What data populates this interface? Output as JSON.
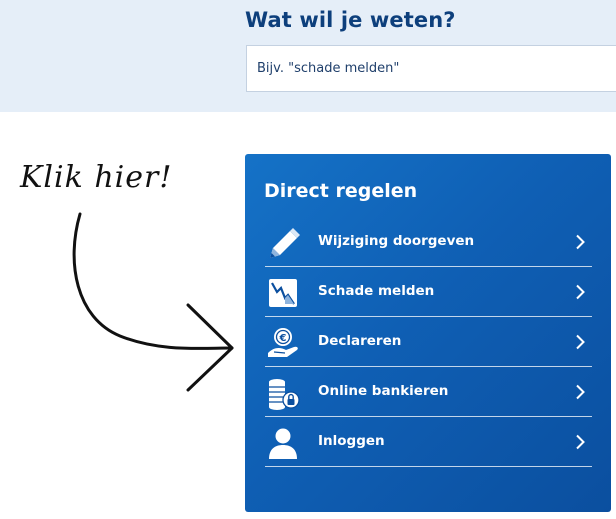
{
  "search": {
    "title": "Wat wil je weten?",
    "placeholder": "Bijv. \"schade melden\""
  },
  "annotation": {
    "text": "Klik hier!"
  },
  "panel": {
    "title": "Direct regelen",
    "items": [
      {
        "label": "Wijziging doorgeven",
        "icon": "pen-icon"
      },
      {
        "label": "Schade melden",
        "icon": "damage-chart-icon"
      },
      {
        "label": "Declareren",
        "icon": "hand-euro-coin-icon"
      },
      {
        "label": "Online bankieren",
        "icon": "coins-lock-icon"
      },
      {
        "label": "Inloggen",
        "icon": "user-icon"
      }
    ]
  },
  "colors": {
    "header_band": "#e5eef8",
    "title_blue": "#0d3f7c",
    "panel_blue": "#0f5fb4",
    "text_white": "#ffffff"
  }
}
